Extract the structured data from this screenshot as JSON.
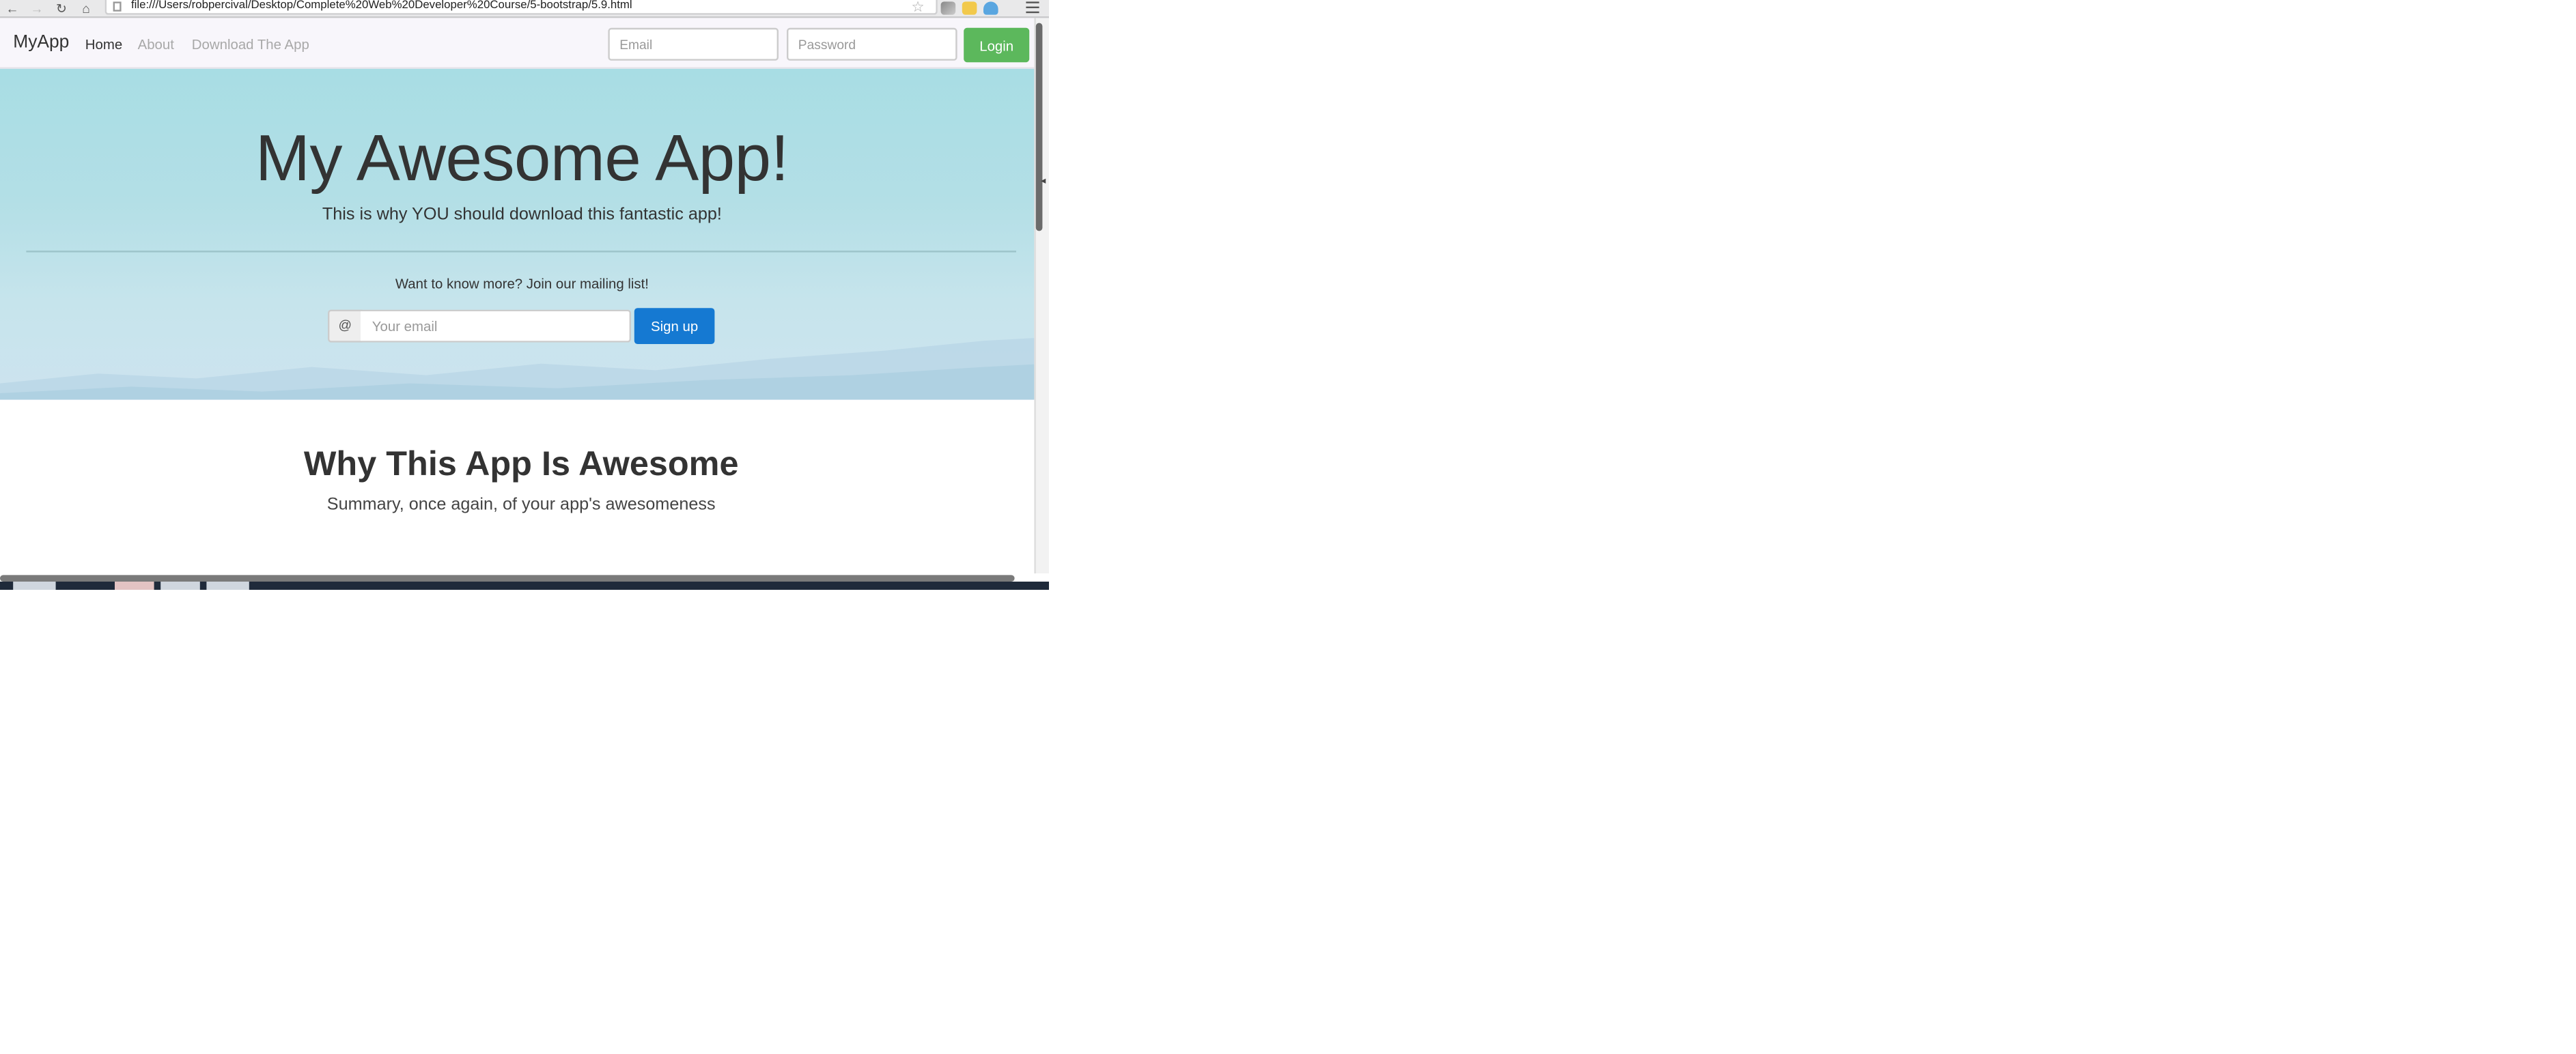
{
  "browser": {
    "url": "file:///Users/robpercival/Desktop/Complete%20Web%20Developer%20Course/5-bootstrap/5.9.html",
    "back_icon": "←",
    "forward_icon": "→",
    "reload_icon": "↻",
    "home_icon": "⌂",
    "star_icon": "☆"
  },
  "navbar": {
    "brand": "MyApp",
    "links": [
      {
        "label": "Home",
        "active": true
      },
      {
        "label": "About",
        "active": false
      },
      {
        "label": "Download The App",
        "active": false
      }
    ],
    "email_placeholder": "Email",
    "password_placeholder": "Password",
    "login_label": "Login"
  },
  "hero": {
    "title": "My Awesome App!",
    "subtitle": "This is why YOU should download this fantastic app!",
    "mailing_text": "Want to know more? Join our mailing list!",
    "addon_symbol": "@",
    "email_placeholder": "Your email",
    "signup_label": "Sign up"
  },
  "section": {
    "title": "Why This App Is Awesome",
    "subtitle": "Summary, once again, of your app's awesomeness"
  },
  "colors": {
    "login_button": "#5cb85c",
    "signup_button": "#1579d2",
    "hero_top": "#a8dde4",
    "hero_bottom": "#cde3ef"
  }
}
